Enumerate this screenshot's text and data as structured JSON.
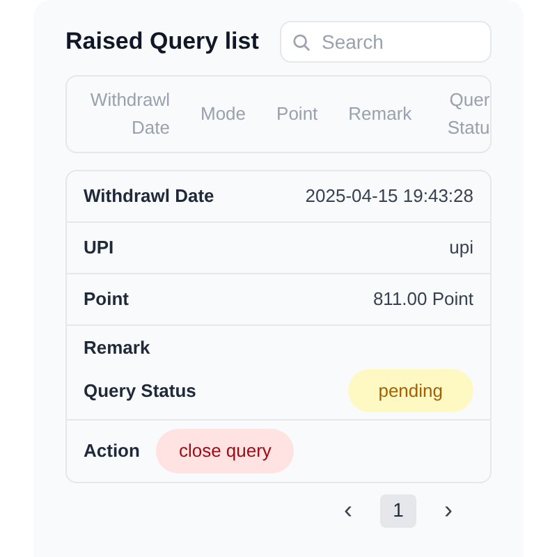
{
  "title": "Raised Query list",
  "search": {
    "placeholder": "Search"
  },
  "columns": [
    "Withdrawl Date",
    "Mode",
    "Point",
    "Remark",
    "Quer Statu"
  ],
  "record": [
    {
      "kind": "text",
      "label": "Withdrawl Date",
      "value": "2025-04-15 19:43:28"
    },
    {
      "kind": "text",
      "label": "UPI",
      "value": "upi"
    },
    {
      "kind": "text",
      "label": "Point",
      "value": "811.00 Point"
    },
    {
      "kind": "text",
      "label": "Remark"
    },
    {
      "kind": "badge",
      "label": "Query Status",
      "value": "pending"
    },
    {
      "kind": "button",
      "label": "Action",
      "value": "close query"
    }
  ],
  "pagination": {
    "prev": "‹",
    "pages": [
      {
        "label": "1",
        "selected": true
      }
    ],
    "next": "›"
  }
}
